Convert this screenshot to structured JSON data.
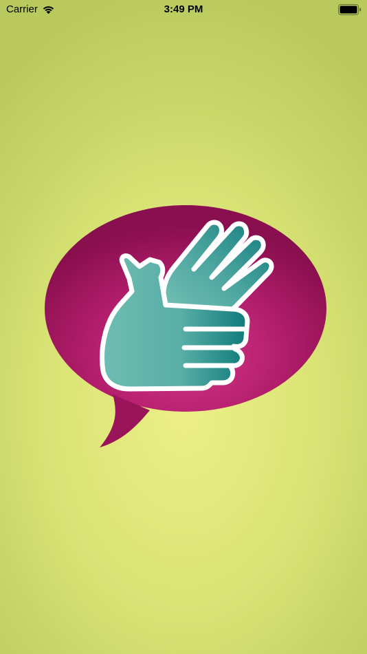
{
  "status_bar": {
    "carrier": "Carrier",
    "time": "3:49 PM",
    "wifi_icon": "wifi-icon",
    "battery_icon": "battery-full-icon"
  },
  "splash": {
    "logo_icon": "sign-language-speech-bubble-icon"
  },
  "colors": {
    "background_center": "#ecef86",
    "background_edge": "#b9c95d",
    "bubble_center": "#d63a8a",
    "bubble_edge": "#8a0f4f",
    "hand_light": "#6fbdb2",
    "hand_dark": "#0e7b7b",
    "outline": "#ffffff"
  }
}
